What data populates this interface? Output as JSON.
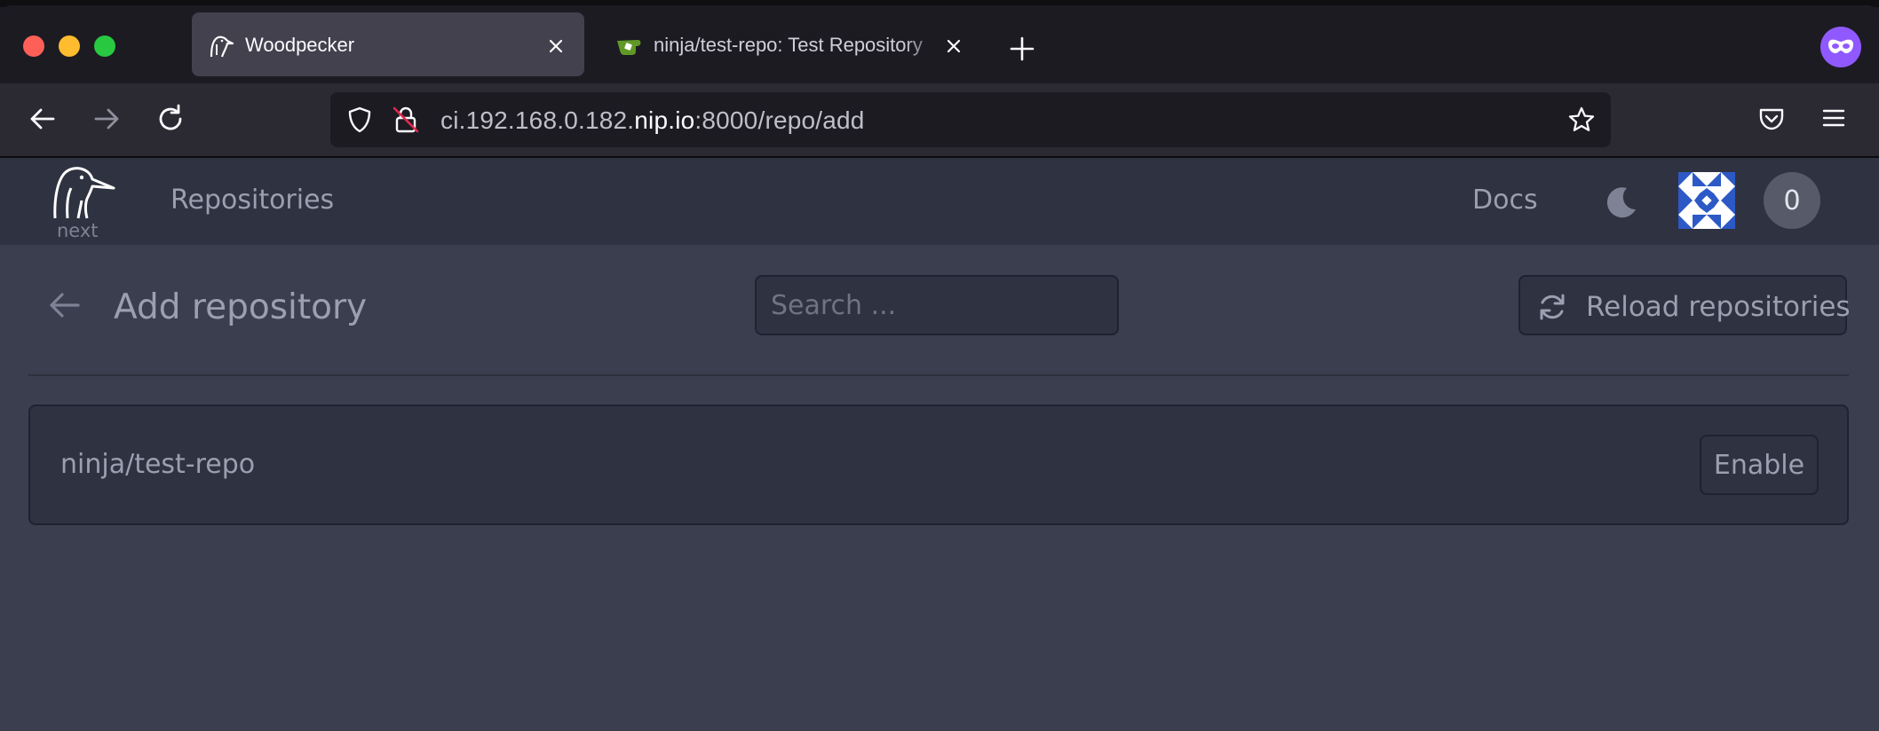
{
  "browser": {
    "tabs": [
      {
        "title": "Woodpecker",
        "icon": "woodpecker-icon",
        "active": true
      },
      {
        "title": "ninja/test-repo: Test Repository",
        "icon": "gitea-icon",
        "active": false
      }
    ],
    "url": {
      "prefix": "ci.192.168.0.182.",
      "domain": "nip.io",
      "suffix": ":8000/repo/add"
    },
    "accent": "#9059ff"
  },
  "app": {
    "header": {
      "logo_sub": "next",
      "nav_repositories": "Repositories",
      "nav_docs": "Docs",
      "count": "0"
    },
    "page": {
      "title": "Add repository",
      "search_placeholder": "Search ...",
      "reload_label": "Reload repositories"
    },
    "repos": [
      {
        "name": "ninja/test-repo",
        "action": "Enable"
      }
    ]
  }
}
